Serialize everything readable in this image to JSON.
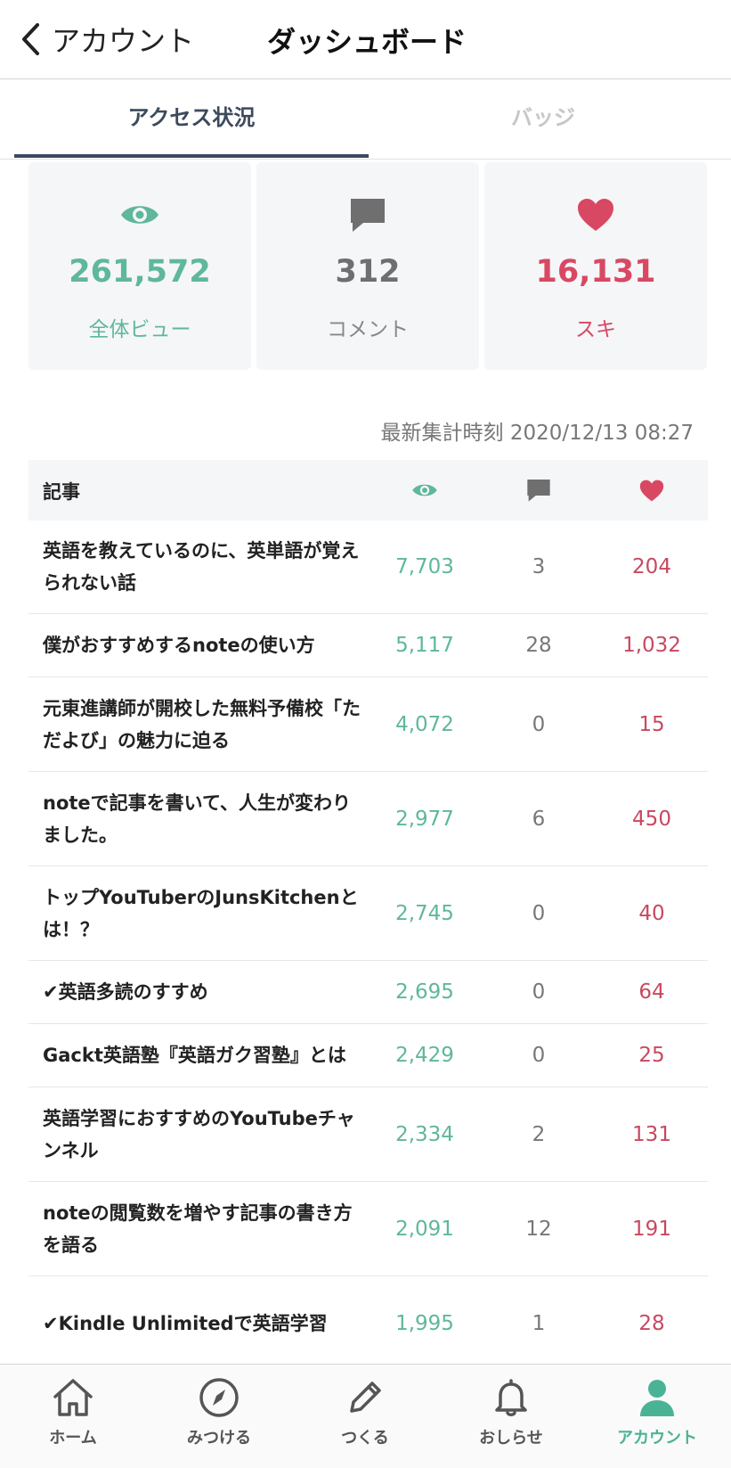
{
  "nav": {
    "back_label": "アカウント",
    "title": "ダッシュボード"
  },
  "tabs": {
    "access": "アクセス状況",
    "badge": "バッジ"
  },
  "stats": {
    "views": {
      "value": "261,572",
      "label": "全体ビュー",
      "color": "#5fb79c",
      "icon": "eye-icon"
    },
    "comments": {
      "value": "312",
      "label": "コメント",
      "color": "#6f6f6f",
      "icon": "comment-icon"
    },
    "likes": {
      "value": "16,131",
      "label": "スキ",
      "color": "#d94863",
      "icon": "heart-icon"
    }
  },
  "updated": "最新集計時刻 2020/12/13 08:27",
  "table": {
    "header": "記事",
    "columns": [
      "eye-icon",
      "comment-icon",
      "heart-icon"
    ],
    "rows": [
      {
        "title": "英語を教えているのに、英単語が覚えられない話",
        "views": "7,703",
        "comments": "3",
        "likes": "204"
      },
      {
        "title": "僕がおすすめするnoteの使い方",
        "views": "5,117",
        "comments": "28",
        "likes": "1,032"
      },
      {
        "title": "元東進講師が開校した無料予備校「ただよび」の魅力に迫る",
        "views": "4,072",
        "comments": "0",
        "likes": "15"
      },
      {
        "title": "noteで記事を書いて、人生が変わりました。",
        "views": "2,977",
        "comments": "6",
        "likes": "450"
      },
      {
        "title": "トップYouTuberのJunsKitchenとは！？",
        "views": "2,745",
        "comments": "0",
        "likes": "40"
      },
      {
        "title": "✔︎英語多読のすすめ",
        "views": "2,695",
        "comments": "0",
        "likes": "64"
      },
      {
        "title": "Gackt英語塾『英語ガク習塾』とは",
        "views": "2,429",
        "comments": "0",
        "likes": "25"
      },
      {
        "title": "英語学習におすすめのYouTubeチャンネル",
        "views": "2,334",
        "comments": "2",
        "likes": "131"
      },
      {
        "title": "noteの閲覧数を増やす記事の書き方を語る",
        "views": "2,091",
        "comments": "12",
        "likes": "191"
      },
      {
        "title": "✔︎Kindle Unlimitedで英語学習",
        "views": "1,995",
        "comments": "1",
        "likes": "28"
      }
    ]
  },
  "tabbar": [
    {
      "label": "ホーム",
      "icon": "home-icon"
    },
    {
      "label": "みつける",
      "icon": "compass-icon"
    },
    {
      "label": "つくる",
      "icon": "pencil-icon"
    },
    {
      "label": "おしらせ",
      "icon": "bell-icon"
    },
    {
      "label": "アカウント",
      "icon": "person-icon",
      "active": true
    }
  ]
}
